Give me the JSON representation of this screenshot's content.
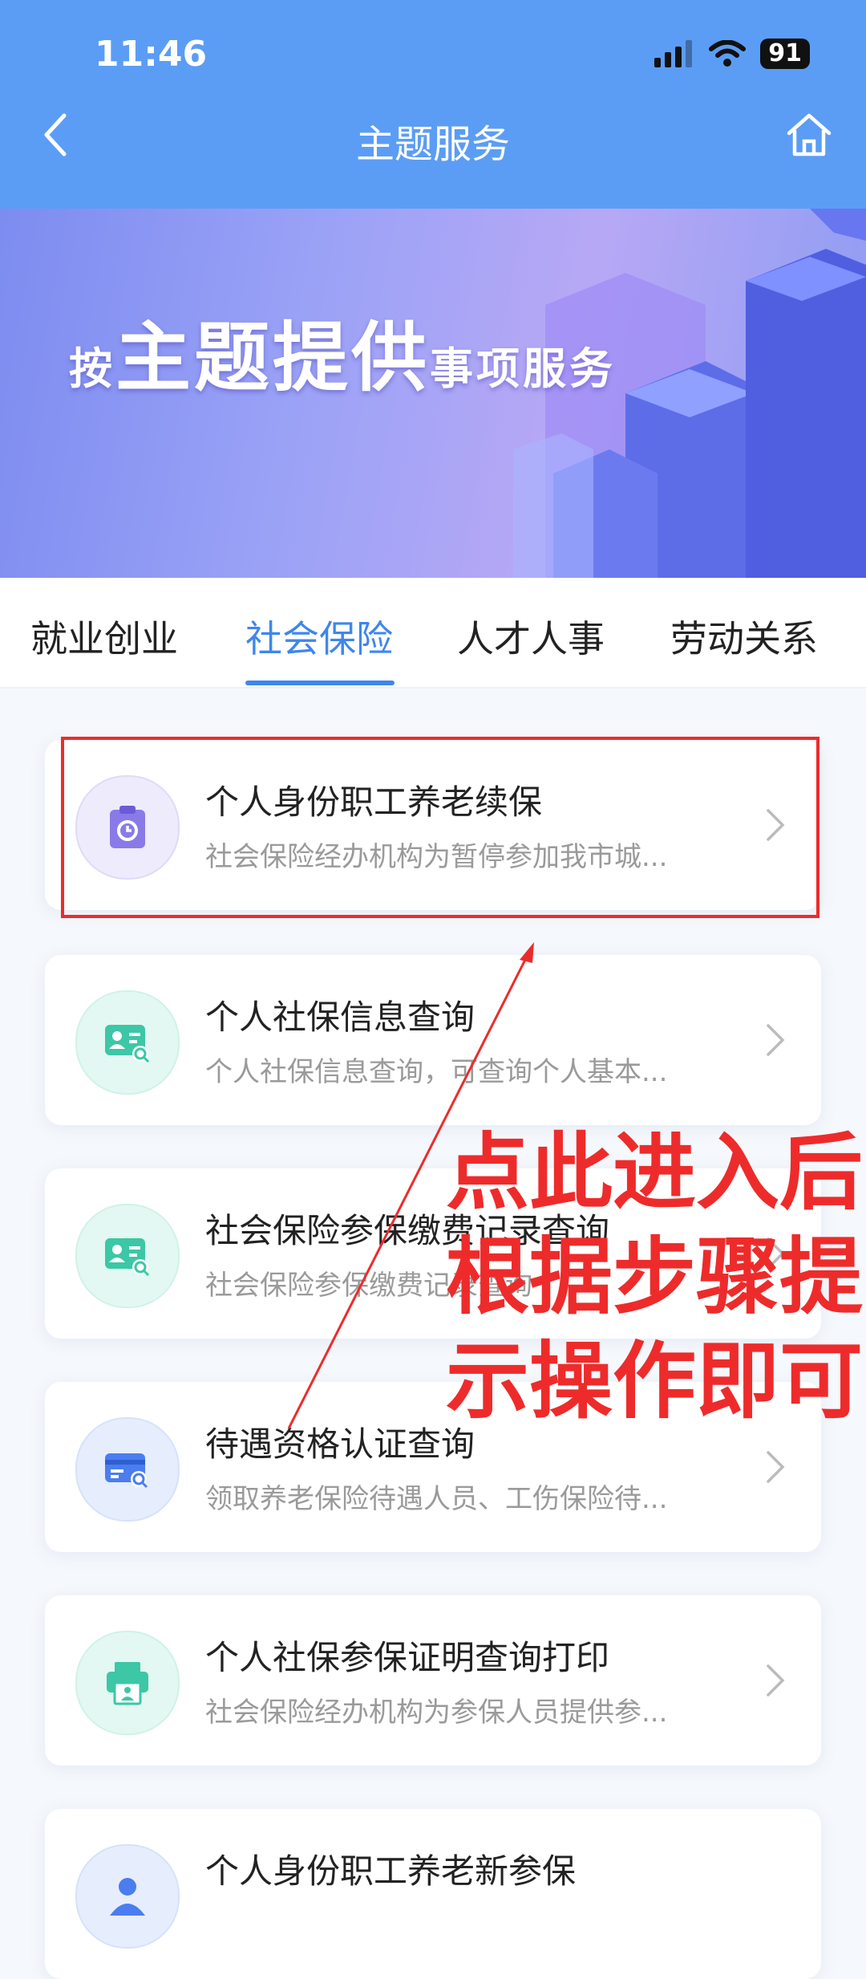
{
  "status_bar": {
    "time": "11:46",
    "battery": "91"
  },
  "nav": {
    "title": "主题服务"
  },
  "banner": {
    "text_small_1": "按",
    "text_big": "主题提供",
    "text_small_2": "事项服务"
  },
  "tabs": [
    {
      "label": "就业创业"
    },
    {
      "label": "社会保险"
    },
    {
      "label": "人才人事"
    },
    {
      "label": "劳动关系"
    }
  ],
  "active_tab": "社会保险",
  "services": [
    {
      "title": "个人身份职工养老续保",
      "desc": "社会保险经办机构为暂停参加我市城...",
      "icon": "clipboard-clock-icon",
      "color": "#8a7ae8"
    },
    {
      "title": "个人社保信息查询",
      "desc": "个人社保信息查询，可查询个人基本...",
      "icon": "id-card-search-icon",
      "color": "#3cc7a6"
    },
    {
      "title": "社会保险参保缴费记录查询",
      "desc": "社会保险参保缴费记录查询",
      "icon": "id-card-search-icon",
      "color": "#3cc7a6"
    },
    {
      "title": "待遇资格认证查询",
      "desc": "领取养老保险待遇人员、工伤保险待...",
      "icon": "card-search-icon",
      "color": "#4b7df0"
    },
    {
      "title": "个人社保参保证明查询打印",
      "desc": "社会保险经办机构为参保人员提供参...",
      "icon": "printer-icon",
      "color": "#3cc7a6"
    },
    {
      "title": "个人身份职工养老新参保",
      "desc": "",
      "icon": "person-icon",
      "color": "#4b7df0"
    }
  ],
  "annotation": {
    "lines": [
      "点此进入后",
      "根据步骤提",
      "示操作即可"
    ],
    "color": "#ee2b2b"
  },
  "colors": {
    "header": "#5b9df5",
    "accent": "#3f86ec"
  }
}
